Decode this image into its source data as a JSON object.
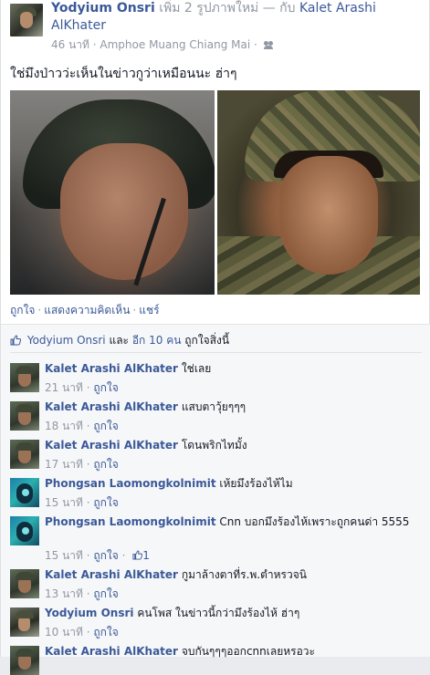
{
  "post": {
    "author": "Yodyium Onsri",
    "action": "เพิ่ม 2 รูปภาพใหม่ — กับ",
    "tagged": "Kalet Arashi AlKhater",
    "time": "46 นาที",
    "location": "Amphoe Muang Chiang Mai",
    "privacy_icon": "friends-icon",
    "text": "ใช่มึงป่าวว่ะเห็นในข่าวกูว่าเหมือนนะ ฮ่าๆ"
  },
  "actions": {
    "like": "ถูกใจ",
    "comment": "แสดงความคิดเห็น",
    "share": "แชร์"
  },
  "likes": {
    "name": "Yodyium Onsri",
    "and_text": "และ",
    "others": "อีก 10 คน",
    "suffix": "ถูกใจสิ่งนี้"
  },
  "comments": [
    {
      "author": "Kalet Arashi AlKhater",
      "text": "ใช่เลย",
      "time": "21 นาที",
      "like": "ถูกใจ",
      "avatar": "k"
    },
    {
      "author": "Kalet Arashi AlKhater",
      "text": "แสบตาวุ้ยๆๆๆ",
      "time": "18 นาที",
      "like": "ถูกใจ",
      "avatar": "k"
    },
    {
      "author": "Kalet Arashi AlKhater",
      "text": "โดนพริกไทมั้ง",
      "time": "17 นาที",
      "like": "ถูกใจ",
      "avatar": "k"
    },
    {
      "author": "Phongsan Laomongkolnimit",
      "text": "เห้ยมึงร้องไห้ไม",
      "time": "15 นาที",
      "like": "ถูกใจ",
      "avatar": "p"
    },
    {
      "author": "Phongsan Laomongkolnimit",
      "text": "Cnn บอกมึงร้องไห้เพราะถูกคนด่า 5555",
      "time": "15 นาที",
      "like": "ถูกใจ",
      "like_count": "1",
      "avatar": "p"
    },
    {
      "author": "Kalet Arashi AlKhater",
      "text": "กูมาล้างตาที่ร.พ.ตำหรวจนิ",
      "time": "13 นาที",
      "like": "ถูกใจ",
      "avatar": "k"
    },
    {
      "author": "Yodyium Onsri",
      "text": "คนโพส ในข่าวนี้กว่ามึงร้องไห้ ฮ่าๆ",
      "time": "10 นาที",
      "like": "ถูกใจ",
      "avatar": "y"
    },
    {
      "author": "Kalet Arashi AlKhater",
      "text": "จบกันๆๆๆออกcnnเลยหรอวะ",
      "time": "",
      "like": "",
      "avatar": "k"
    }
  ],
  "colors": {
    "link": "#3b5998",
    "meta": "#9197a3",
    "feedback_bg": "#f6f7f9"
  }
}
